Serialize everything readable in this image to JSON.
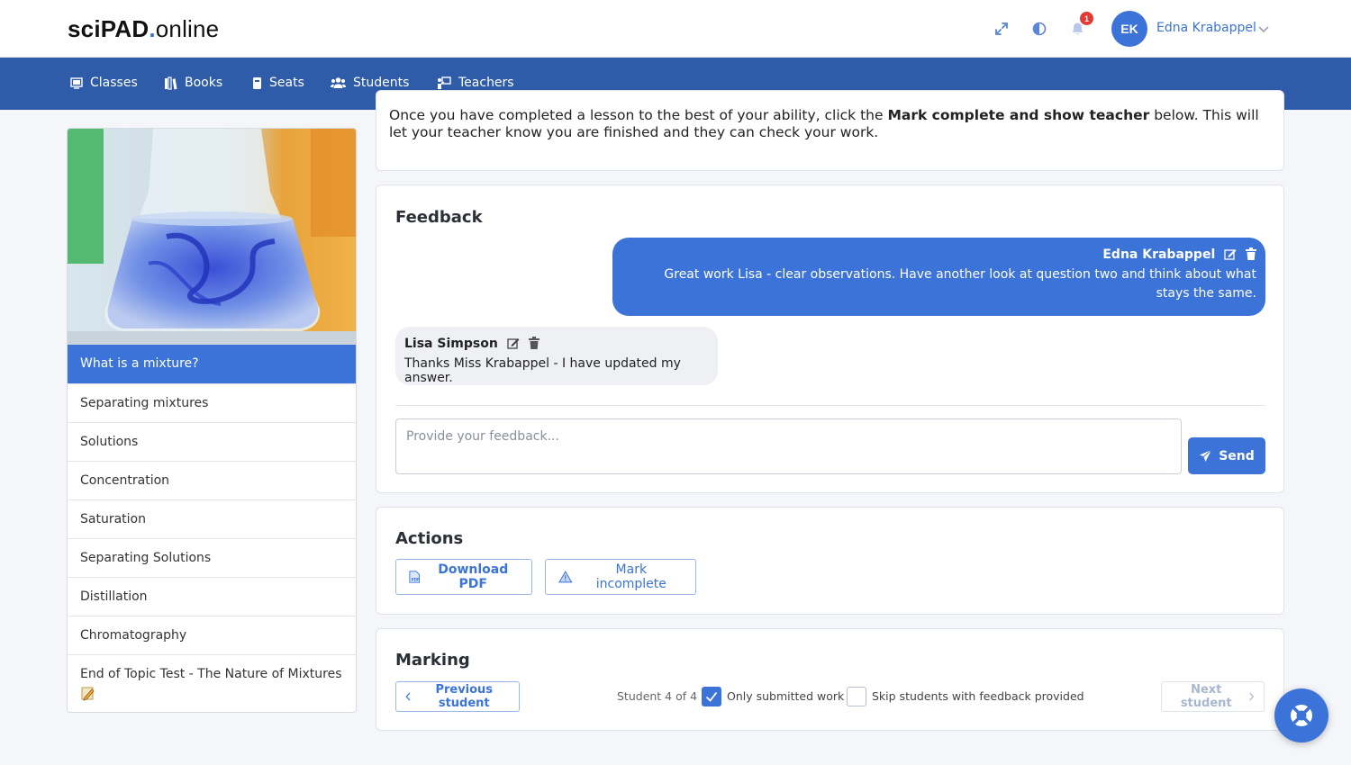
{
  "header": {
    "logo_sci": "sciPAD",
    "logo_dot": ".",
    "logo_online": "online",
    "notification_count": "1",
    "user_initials": "EK",
    "user_name": "Edna Krabappel"
  },
  "nav": {
    "items": [
      {
        "label": "Classes",
        "icon": "class-icon"
      },
      {
        "label": "Books",
        "icon": "books-icon"
      },
      {
        "label": "Seats",
        "icon": "seat-icon"
      },
      {
        "label": "Students",
        "icon": "students-icon"
      },
      {
        "label": "Teachers",
        "icon": "teachers-icon"
      }
    ]
  },
  "sidebar": {
    "image": "beaker-with-blue-ink-image",
    "items": [
      {
        "label": "What is a mixture?",
        "active": true
      },
      {
        "label": "Separating mixtures"
      },
      {
        "label": "Solutions"
      },
      {
        "label": "Concentration"
      },
      {
        "label": "Saturation"
      },
      {
        "label": "Separating Solutions"
      },
      {
        "label": "Distillation"
      },
      {
        "label": "Chromatography"
      },
      {
        "label": "End of Topic Test - The Nature of Mixtures"
      }
    ]
  },
  "intro": {
    "text_before": "Once you have completed a lesson to the best of your ability, click the ",
    "text_bold": "Mark complete and show teacher",
    "text_after": " below. This will let your teacher know you are finished and they can check your work."
  },
  "feedback": {
    "title": "Feedback",
    "messages": [
      {
        "author": "Edna Krabappel",
        "text": "Great work Lisa - clear observations. Have another look at question two and think about what stays the same."
      },
      {
        "author": "Lisa Simpson",
        "text": "Thanks Miss Krabappel - I have updated my answer."
      }
    ],
    "input_placeholder": "Provide your feedback...",
    "send_label": "Send"
  },
  "actions": {
    "title": "Actions",
    "download_label": "Download PDF",
    "mark_incomplete_label": "Mark incomplete"
  },
  "marking": {
    "title": "Marking",
    "previous_label": "Previous student",
    "counter": "Student 4 of 4",
    "only_submitted_label": "Only submitted work",
    "only_submitted_checked": true,
    "skip_feedback_label": "Skip students with feedback provided",
    "skip_feedback_checked": false,
    "next_label": "Next student"
  },
  "colors": {
    "accent": "#3b73d9",
    "nav_bg": "#2f5ca8",
    "page_bg": "#f4f6fa"
  }
}
